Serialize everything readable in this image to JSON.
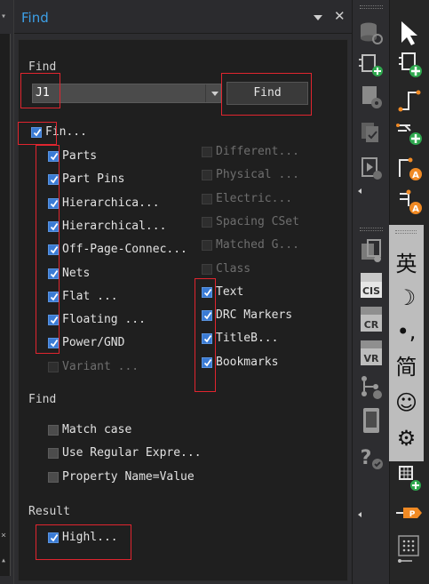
{
  "panel": {
    "title": "Find",
    "find_section_label": "Find",
    "search": {
      "value": "J1"
    },
    "find_button": "Find",
    "find_all": {
      "label": "Fin...",
      "checked": true
    },
    "object_types_left": [
      {
        "label": "Parts",
        "checked": true
      },
      {
        "label": "Part Pins",
        "checked": true
      },
      {
        "label": "Hierarchica...",
        "checked": true
      },
      {
        "label": "Hierarchical...",
        "checked": true
      },
      {
        "label": "Off-Page-Connec...",
        "checked": true
      },
      {
        "label": "Nets",
        "checked": true
      },
      {
        "label": "Flat ...",
        "checked": true
      },
      {
        "label": "Floating ...",
        "checked": true
      },
      {
        "label": "Power/GND",
        "checked": true
      },
      {
        "label": "Variant ...",
        "checked": false,
        "disabled": true
      }
    ],
    "object_types_right": [
      {
        "label": "Different...",
        "checked": false,
        "disabled": true
      },
      {
        "label": "Physical ...",
        "checked": false,
        "disabled": true
      },
      {
        "label": "Electric...",
        "checked": false,
        "disabled": true
      },
      {
        "label": "Spacing CSet",
        "checked": false,
        "disabled": true
      },
      {
        "label": "Matched G...",
        "checked": false,
        "disabled": true
      },
      {
        "label": "Class",
        "checked": false,
        "disabled": true
      },
      {
        "label": "Text",
        "checked": true
      },
      {
        "label": "DRC Markers",
        "checked": true
      },
      {
        "label": "TitleB...",
        "checked": true
      },
      {
        "label": "Bookmarks",
        "checked": true
      }
    ],
    "options_label": "Find",
    "options": [
      {
        "label": "Match case",
        "checked": false
      },
      {
        "label": "Use Regular Expre...",
        "checked": false
      },
      {
        "label": "Property Name=Value",
        "checked": false
      }
    ],
    "result_label": "Result",
    "result_option": {
      "label": "Highl...",
      "checked": true
    }
  },
  "toolbar_mid": [
    {
      "icon": "database-search-icon"
    },
    {
      "icon": "add-part-list-icon"
    },
    {
      "icon": "document-settings-icon"
    },
    {
      "icon": "copy-check-icon"
    },
    {
      "icon": "import-run-icon"
    },
    {
      "icon": "netlist-icon"
    },
    {
      "icon": "cis-icon",
      "label": "CIS"
    },
    {
      "icon": "cr-icon",
      "label": "CR"
    },
    {
      "icon": "vr-icon",
      "label": "VR"
    },
    {
      "icon": "tree-add-icon"
    },
    {
      "icon": "phone-layout-icon"
    },
    {
      "icon": "help-check-icon"
    }
  ],
  "toolbar_right": [
    {
      "icon": "select-pointer-icon"
    },
    {
      "icon": "place-part-icon"
    },
    {
      "icon": "place-wire-icon"
    },
    {
      "icon": "place-bus-icon"
    },
    {
      "icon": "auto-wire-icon"
    },
    {
      "icon": "auto-connect-icon"
    },
    {
      "icon": "place-grid-icon"
    },
    {
      "icon": "place-offpage-icon"
    },
    {
      "icon": "grid-dots-icon"
    }
  ],
  "ime": {
    "items": [
      "英",
      "☽",
      "•,",
      "简",
      "☺",
      "⚙"
    ]
  },
  "colors": {
    "accent": "#3d9fe6",
    "checkbox": "#3a7bd5",
    "highlight_frame": "#e0252f",
    "panel_bg": "#1f1f1f"
  }
}
